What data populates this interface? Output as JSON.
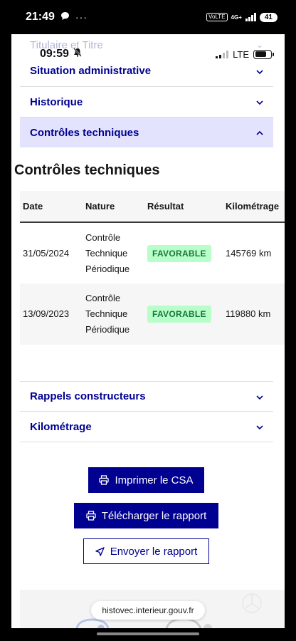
{
  "outer_status": {
    "time": "21:49",
    "network": "4G+",
    "lte_badge": "VoLTE",
    "battery": "41"
  },
  "inner_status": {
    "time": "09:59",
    "network": "LTE"
  },
  "accordion_top": [
    {
      "label": "Titulaire et Titre"
    },
    {
      "label": "Situation administrative"
    },
    {
      "label": "Historique"
    },
    {
      "label": "Contrôles techniques"
    }
  ],
  "section": {
    "title": "Contrôles techniques"
  },
  "table": {
    "headers": [
      "Date",
      "Nature",
      "Résultat",
      "Kilométrage"
    ],
    "rows": [
      {
        "date": "31/05/2024",
        "nature_lines": [
          "Contrôle",
          "Technique",
          "Périodique"
        ],
        "result": "FAVORABLE",
        "km": "145769 km"
      },
      {
        "date": "13/09/2023",
        "nature_lines": [
          "Contrôle",
          "Technique",
          "Périodique"
        ],
        "result": "FAVORABLE",
        "km": "119880 km"
      }
    ]
  },
  "accordion_bottom": [
    {
      "label": "Rappels constructeurs"
    },
    {
      "label": "Kilométrage"
    }
  ],
  "buttons": {
    "print": "Imprimer le CSA",
    "download": "Télécharger le rapport",
    "send": "Envoyer le rapport"
  },
  "browser": {
    "url": "histovec.interieur.gouv.fr"
  },
  "colors": {
    "primary": "#000091",
    "badge_bg": "#b8fec9",
    "badge_text": "#18753c",
    "active_row": "#e3e3fd"
  }
}
